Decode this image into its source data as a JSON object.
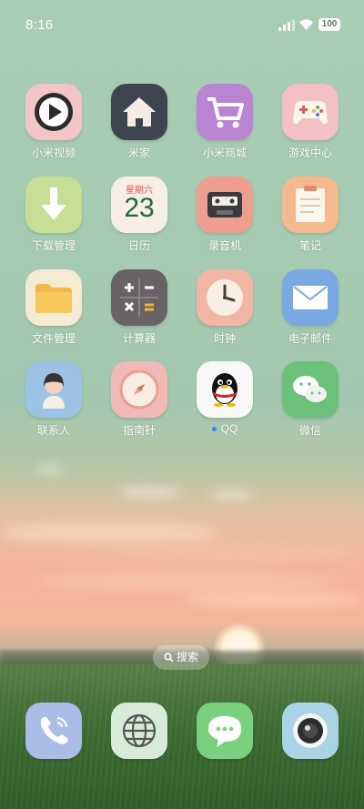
{
  "status_bar": {
    "time": "8:16",
    "battery": "100"
  },
  "apps": [
    {
      "id": "mi-video",
      "label": "小米视频"
    },
    {
      "id": "mi-home",
      "label": "米家"
    },
    {
      "id": "mi-store",
      "label": "小米商城"
    },
    {
      "id": "game-center",
      "label": "游戏中心"
    },
    {
      "id": "downloads",
      "label": "下载管理"
    },
    {
      "id": "calendar",
      "label": "日历",
      "icon_weekday": "星期六",
      "icon_day": "23"
    },
    {
      "id": "recorder",
      "label": "录音机"
    },
    {
      "id": "notes",
      "label": "笔记"
    },
    {
      "id": "file-manager",
      "label": "文件管理"
    },
    {
      "id": "calculator",
      "label": "计算器"
    },
    {
      "id": "clock",
      "label": "时钟"
    },
    {
      "id": "email",
      "label": "电子邮件"
    },
    {
      "id": "contacts",
      "label": "联系人"
    },
    {
      "id": "compass",
      "label": "指南针"
    },
    {
      "id": "qq",
      "label": "QQ",
      "new_install_dot": true
    },
    {
      "id": "wechat",
      "label": "微信"
    }
  ],
  "search": {
    "label": "搜索"
  },
  "dock": [
    {
      "id": "phone",
      "icon": "phone-icon"
    },
    {
      "id": "browser",
      "icon": "globe-icon"
    },
    {
      "id": "messages",
      "icon": "chat-bubble-icon"
    },
    {
      "id": "camera",
      "icon": "camera-icon"
    }
  ],
  "colors": {
    "accent_dot": "#3f7bff"
  }
}
